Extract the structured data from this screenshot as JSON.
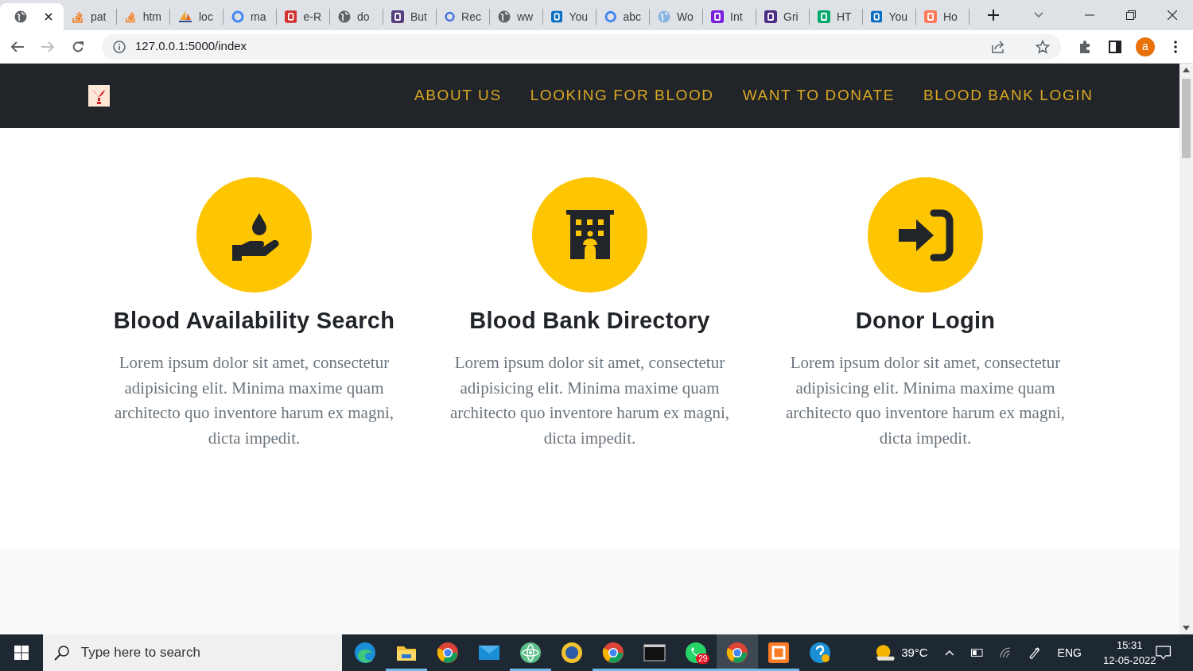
{
  "browser": {
    "tabs": [
      {
        "kind": "globe",
        "color": "#5f6368",
        "selected": true
      },
      {
        "kind": "stack",
        "color": "#f48024",
        "title": "pat",
        "selected": false
      },
      {
        "kind": "stack",
        "color": "#f48024",
        "title": "htm",
        "selected": false
      },
      {
        "kind": "sail",
        "color": "#f0a030",
        "title": "loc",
        "selected": false
      },
      {
        "kind": "ring",
        "color": "#4285f4",
        "title": "ma",
        "selected": false
      },
      {
        "kind": "tile",
        "color": "#d32f2f",
        "title": "e-R",
        "selected": false
      },
      {
        "kind": "globe",
        "color": "#5f6368",
        "title": "do",
        "selected": false
      },
      {
        "kind": "tile",
        "color": "#563d7c",
        "title": "But",
        "selected": false
      },
      {
        "kind": "ring",
        "color": "#3b6fe0",
        "title": "Rec",
        "selected": false
      },
      {
        "kind": "globe",
        "color": "#5f6368",
        "title": "ww",
        "selected": false
      },
      {
        "kind": "tile",
        "color": "#0a6fc2",
        "title": "You",
        "selected": false
      },
      {
        "kind": "ring",
        "color": "#4285f4",
        "title": "abc",
        "selected": false
      },
      {
        "kind": "globe",
        "color": "#8ab4e0",
        "title": "Wo",
        "selected": false
      },
      {
        "kind": "tile",
        "color": "#7a1fe0",
        "title": "Int",
        "selected": false
      },
      {
        "kind": "tile",
        "color": "#4b2e83",
        "title": "Gri",
        "selected": false
      },
      {
        "kind": "tile",
        "color": "#04aa6d",
        "title": "HT",
        "selected": false
      },
      {
        "kind": "tile",
        "color": "#0a6fc2",
        "title": "You",
        "selected": false
      },
      {
        "kind": "tile",
        "color": "#ff7a59",
        "title": "Ho",
        "selected": false
      }
    ],
    "url": "127.0.0.1:5000/index",
    "profile_initial": "a"
  },
  "navbar": {
    "links": [
      "ABOUT US",
      "LOOKING FOR BLOOD",
      "WANT TO DONATE",
      "BLOOD BANK LOGIN"
    ]
  },
  "features": [
    {
      "kind": "hand-drop",
      "title": "Blood Availability Search",
      "text": "Lorem ipsum dolor sit amet, consectetur adipisicing elit. Minima maxime quam architecto quo inventore harum ex magni, dicta impedit."
    },
    {
      "kind": "building",
      "title": "Blood Bank Directory",
      "text": "Lorem ipsum dolor sit amet, consectetur adipisicing elit. Minima maxime quam architecto quo inventore harum ex magni, dicta impedit."
    },
    {
      "kind": "sign-in",
      "title": "Donor Login",
      "text": "Lorem ipsum dolor sit amet, consectetur adipisicing elit. Minima maxime quam architecto quo inventore harum ex magni, dicta impedit."
    }
  ],
  "taskbar": {
    "search_placeholder": "Type here to search",
    "apps": [
      {
        "kind": "edge",
        "running": false,
        "selected": false
      },
      {
        "kind": "folder",
        "running": true,
        "selected": false
      },
      {
        "kind": "chrome",
        "running": false,
        "selected": false
      },
      {
        "kind": "mail",
        "running": false,
        "selected": false
      },
      {
        "kind": "atom",
        "running": true,
        "selected": false
      },
      {
        "kind": "badge-app",
        "running": false,
        "selected": false
      },
      {
        "kind": "chrome",
        "running": true,
        "selected": false
      },
      {
        "kind": "terminal",
        "running": true,
        "selected": false
      },
      {
        "kind": "chat",
        "running": true,
        "selected": false,
        "badge": "29"
      },
      {
        "kind": "chrome",
        "running": true,
        "selected": true
      },
      {
        "kind": "xampp",
        "running": true,
        "selected": false
      },
      {
        "kind": "help",
        "running": false,
        "selected": false
      }
    ],
    "temperature": "39°C",
    "language": "ENG",
    "time": "15:31",
    "date": "12-05-2022"
  }
}
